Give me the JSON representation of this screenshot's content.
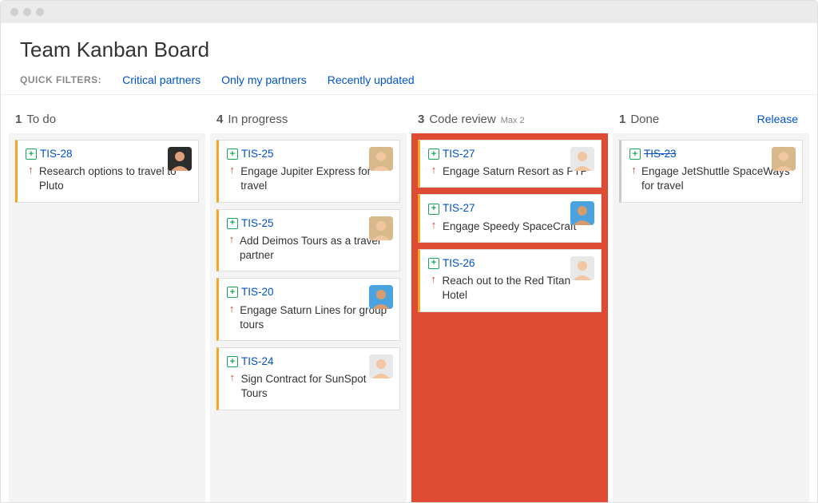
{
  "board": {
    "title": "Team Kanban Board",
    "filters_label": "QUICK FILTERS:",
    "filters": [
      "Critical partners",
      "Only my partners",
      "Recently updated"
    ],
    "release_label": "Release"
  },
  "columns": [
    {
      "count": "1",
      "name": "To do",
      "max": "",
      "over": false,
      "cards": [
        {
          "key": "TIS-28",
          "summary": "Research options to travel to Pluto",
          "avatar": "a",
          "done": false
        }
      ]
    },
    {
      "count": "4",
      "name": "In progress",
      "max": "",
      "over": false,
      "cards": [
        {
          "key": "TIS-25",
          "summary": "Engage Jupiter Express for travel",
          "avatar": "b",
          "done": false
        },
        {
          "key": "TIS-25",
          "summary": "Add Deimos Tours as a travel partner",
          "avatar": "b",
          "done": false
        },
        {
          "key": "TIS-20",
          "summary": "Engage Saturn Lines for group tours",
          "avatar": "c",
          "done": false
        },
        {
          "key": "TIS-24",
          "summary": "Sign Contract for SunSpot Tours",
          "avatar": "d",
          "done": false
        }
      ]
    },
    {
      "count": "3",
      "name": "Code review",
      "max": "Max 2",
      "over": true,
      "cards": [
        {
          "key": "TIS-27",
          "summary": "Engage Saturn Resort as PTP",
          "avatar": "d",
          "done": false
        },
        {
          "key": "TIS-27",
          "summary": "Engage Speedy SpaceCraft",
          "avatar": "c",
          "done": false
        },
        {
          "key": "TIS-26",
          "summary": "Reach out to the Red Titan Hotel",
          "avatar": "d",
          "done": false
        }
      ]
    },
    {
      "count": "1",
      "name": "Done",
      "max": "",
      "over": false,
      "cards": [
        {
          "key": "TIS-23",
          "summary": "Engage JetShuttle SpaceWays for travel",
          "avatar": "b",
          "done": true
        }
      ]
    }
  ],
  "avatars": {
    "a": {
      "bg": "#2c2c2c",
      "skin": "#e0a07c"
    },
    "b": {
      "bg": "#d8b98c",
      "skin": "#f1c6a1"
    },
    "c": {
      "bg": "#4aa3df",
      "skin": "#d89b6e"
    },
    "d": {
      "bg": "#e8e8e8",
      "skin": "#f1c6a1"
    }
  }
}
